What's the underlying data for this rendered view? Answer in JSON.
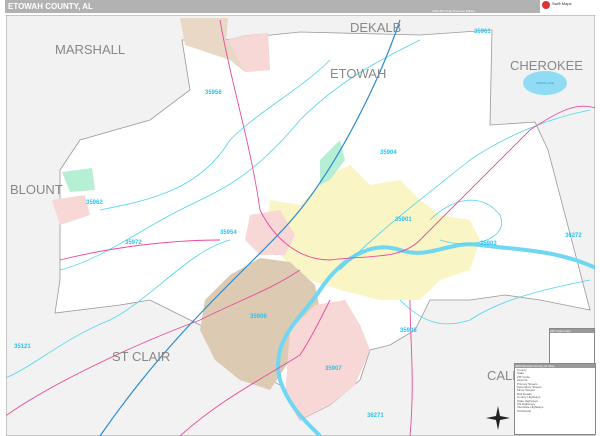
{
  "header": {
    "title": "ETOWAH COUNTY, AL",
    "edition": "2020 ZIP Code Premium Edition",
    "logo_text": "Swift Maps"
  },
  "counties": {
    "marshall": "MARSHALL",
    "dekalb": "DEKALB",
    "etowah": "ETOWAH",
    "cherokee": "CHEROKEE",
    "blount": "BLOUNT",
    "st_clair": "ST CLAIR",
    "calhoun": "CALH"
  },
  "lake": {
    "name": "WEISS LAKE"
  },
  "zips": [
    "35956",
    "35904",
    "35901",
    "35903",
    "36272",
    "35962",
    "35972",
    "35954",
    "35906",
    "35907",
    "35905",
    "36271",
    "35121",
    "35961"
  ],
  "legend": {
    "title": "2020 Etowah County, AL Map",
    "rows": [
      "County",
      "State",
      "ZIP Code",
      "Airports",
      "Primary Streets",
      "Secondary Streets",
      "Minor Streets",
      "Rail Roads",
      "County Highways",
      "State Highways",
      "US Highways",
      "Interstate Highways",
      "Toll Roads"
    ]
  },
  "index": {
    "title": "ZIP Code Index"
  },
  "colors": {
    "zip_line": "#4fd4f0",
    "highway": "#e84c9c",
    "interstate": "#2a8bd0",
    "city_yellow": "#faf5c4",
    "city_brown": "#dccab3",
    "city_pink": "#f8d7d7",
    "outside": "#f2f2f2"
  }
}
